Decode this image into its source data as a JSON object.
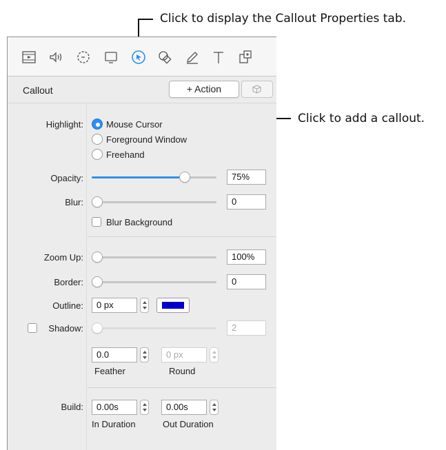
{
  "annotations": {
    "tab_callout": "Click to display the Callout Properties tab.",
    "action_callout": "Click to add a callout."
  },
  "toolbar": {
    "icons": [
      "video-icon",
      "audio-icon",
      "timer-icon",
      "screen-icon",
      "cursor-icon",
      "shapes-icon",
      "pen-icon",
      "text-icon",
      "layers-icon"
    ],
    "active": "cursor-icon"
  },
  "header": {
    "title": "Callout",
    "action_label": "+ Action"
  },
  "highlight": {
    "label": "Highlight:",
    "options": [
      "Mouse Cursor",
      "Foreground Window",
      "Freehand"
    ],
    "selected": "Mouse Cursor"
  },
  "opacity": {
    "label": "Opacity:",
    "value": "75%",
    "level": 0.75
  },
  "blur": {
    "label": "Blur:",
    "value": "0",
    "level": 0
  },
  "blur_background": {
    "label": "Blur Background",
    "checked": false
  },
  "zoom_up": {
    "label": "Zoom Up:",
    "value": "100%",
    "level": 0
  },
  "border": {
    "label": "Border:",
    "value": "0",
    "level": 0
  },
  "outline": {
    "label": "Outline:",
    "value": "0 px",
    "color": "#0000cc"
  },
  "shadow": {
    "label": "Shadow:",
    "checked": false,
    "value": "2",
    "level": 0,
    "feather_value": "0.0",
    "feather_label": "Feather",
    "round_value": "0 px",
    "round_label": "Round"
  },
  "build": {
    "label": "Build:",
    "in_value": "0.00s",
    "in_label": "In Duration",
    "out_value": "0.00s",
    "out_label": "Out Duration"
  },
  "colors": {
    "accent": "#2d8ff0",
    "panel_bg": "#ececec"
  }
}
